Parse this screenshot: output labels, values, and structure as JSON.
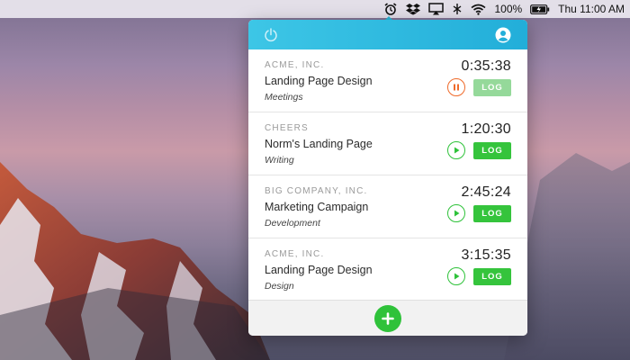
{
  "menubar": {
    "battery_text": "100%",
    "clock_text": "Thu 11:00 AM",
    "icons": [
      "alarm-clock-icon",
      "dropbox-icon",
      "airplay-icon",
      "app-icon",
      "wifi-icon",
      "battery-icon"
    ]
  },
  "header": {
    "power_icon": "power-icon",
    "profile_icon": "user-profile-icon"
  },
  "entries": [
    {
      "client": "ACME, INC.",
      "project": "Landing Page Design",
      "task": "Meetings",
      "time": "0:35:38",
      "state": "running",
      "log_label": "LOG"
    },
    {
      "client": "CHEERS",
      "project": "Norm's Landing Page",
      "task": "Writing",
      "time": "1:20:30",
      "state": "paused",
      "log_label": "LOG"
    },
    {
      "client": "BIG COMPANY, INC.",
      "project": "Marketing Campaign",
      "task": "Development",
      "time": "2:45:24",
      "state": "paused",
      "log_label": "LOG"
    },
    {
      "client": "ACME, INC.",
      "project": "Landing Page Design",
      "task": "Design",
      "time": "3:15:35",
      "state": "paused",
      "log_label": "LOG"
    }
  ],
  "footer": {
    "add_icon": "plus-icon"
  },
  "colors": {
    "header_start": "#3dc6e6",
    "header_end": "#22aed9",
    "play_green": "#2fc23a",
    "pause_orange": "#ef6a2a",
    "log_green": "#35c43c",
    "log_disabled": "#95d99a"
  }
}
